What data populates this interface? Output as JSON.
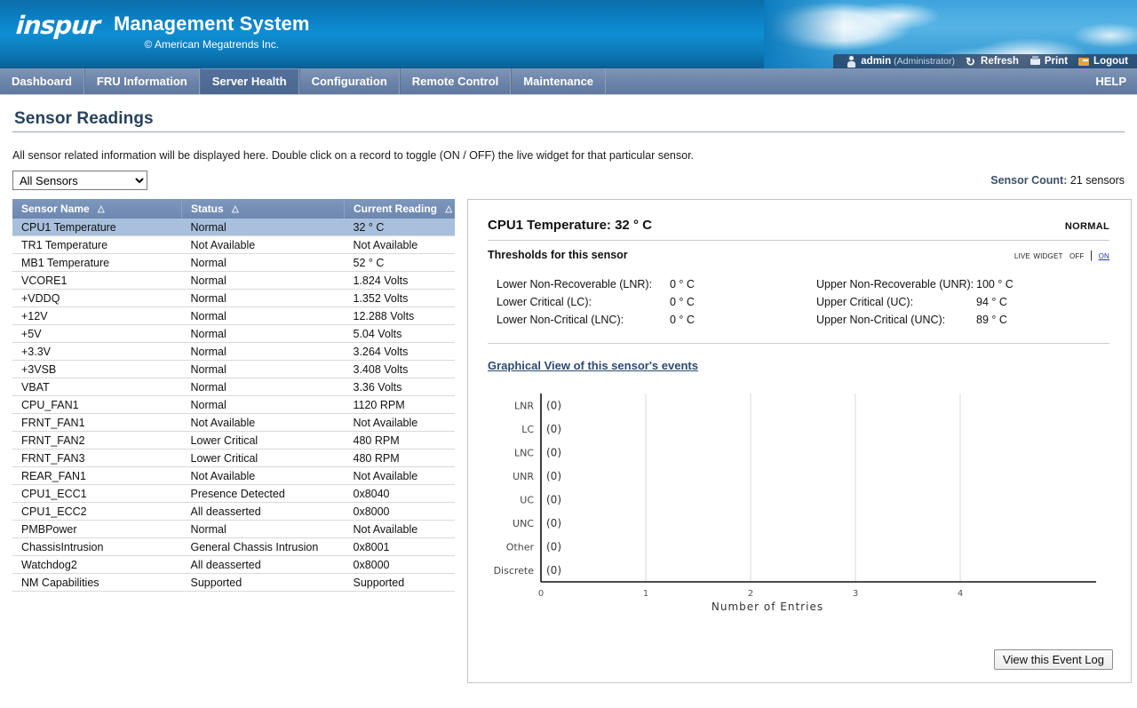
{
  "header": {
    "logo_text": "inspur",
    "title": "Management System",
    "subtitle": "© American Megatrends Inc.",
    "user": {
      "name": "admin",
      "role": "(Administrator)"
    },
    "actions": [
      {
        "label": "Refresh",
        "icon": "refresh-icon"
      },
      {
        "label": "Print",
        "icon": "print-icon"
      },
      {
        "label": "Logout",
        "icon": "logout-icon"
      }
    ]
  },
  "nav": {
    "items": [
      {
        "label": "Dashboard",
        "active": false
      },
      {
        "label": "FRU Information",
        "active": false
      },
      {
        "label": "Server Health",
        "active": true
      },
      {
        "label": "Configuration",
        "active": false
      },
      {
        "label": "Remote Control",
        "active": false
      },
      {
        "label": "Maintenance",
        "active": false
      }
    ],
    "help_label": "HELP"
  },
  "page": {
    "title": "Sensor Readings",
    "description": "All sensor related information will be displayed here. Double click on a record to toggle (ON / OFF) the live widget for that particular sensor.",
    "filter_selected": "All Sensors",
    "filter_options": [
      "All Sensors"
    ],
    "sensor_count_label": "Sensor Count:",
    "sensor_count_value": "21 sensors"
  },
  "table": {
    "columns": [
      "Sensor Name",
      "Status",
      "Current Reading"
    ],
    "sort_icon": "△",
    "rows": [
      {
        "name": "CPU1 Temperature",
        "status": "Normal",
        "reading": "32 ° C",
        "selected": true
      },
      {
        "name": "TR1 Temperature",
        "status": "Not Available",
        "reading": "Not Available",
        "selected": false
      },
      {
        "name": "MB1 Temperature",
        "status": "Normal",
        "reading": "52 ° C",
        "selected": false
      },
      {
        "name": "VCORE1",
        "status": "Normal",
        "reading": "1.824 Volts",
        "selected": false
      },
      {
        "name": "+VDDQ",
        "status": "Normal",
        "reading": "1.352 Volts",
        "selected": false
      },
      {
        "name": "+12V",
        "status": "Normal",
        "reading": "12.288 Volts",
        "selected": false
      },
      {
        "name": "+5V",
        "status": "Normal",
        "reading": "5.04 Volts",
        "selected": false
      },
      {
        "name": "+3.3V",
        "status": "Normal",
        "reading": "3.264 Volts",
        "selected": false
      },
      {
        "name": "+3VSB",
        "status": "Normal",
        "reading": "3.408 Volts",
        "selected": false
      },
      {
        "name": "VBAT",
        "status": "Normal",
        "reading": "3.36 Volts",
        "selected": false
      },
      {
        "name": "CPU_FAN1",
        "status": "Normal",
        "reading": "1120 RPM",
        "selected": false
      },
      {
        "name": "FRNT_FAN1",
        "status": "Not Available",
        "reading": "Not Available",
        "selected": false
      },
      {
        "name": "FRNT_FAN2",
        "status": "Lower Critical",
        "reading": "480 RPM",
        "selected": false
      },
      {
        "name": "FRNT_FAN3",
        "status": "Lower Critical",
        "reading": "480 RPM",
        "selected": false
      },
      {
        "name": "REAR_FAN1",
        "status": "Not Available",
        "reading": "Not Available",
        "selected": false
      },
      {
        "name": "CPU1_ECC1",
        "status": "Presence Detected",
        "reading": "0x8040",
        "selected": false
      },
      {
        "name": "CPU1_ECC2",
        "status": "All deasserted",
        "reading": "0x8000",
        "selected": false
      },
      {
        "name": "PMBPower",
        "status": "Normal",
        "reading": "Not Available",
        "selected": false
      },
      {
        "name": "ChassisIntrusion",
        "status": "General Chassis Intrusion",
        "reading": "0x8001",
        "selected": false
      },
      {
        "name": "Watchdog2",
        "status": "All deasserted",
        "reading": "0x8000",
        "selected": false
      },
      {
        "name": "NM Capabilities",
        "status": "Supported",
        "reading": "Supported",
        "selected": false
      }
    ]
  },
  "detail": {
    "title": "CPU1 Temperature: 32 ° C",
    "status": "Normal",
    "thresholds_label": "Thresholds for this sensor",
    "live_widget": {
      "label": "Live Widget",
      "off": "Off",
      "separator": "|",
      "on": "On"
    },
    "thresholds_left": [
      {
        "key": "Lower Non-Recoverable (LNR):",
        "value": "0 ° C"
      },
      {
        "key": "Lower Critical (LC):",
        "value": "0 ° C"
      },
      {
        "key": "Lower Non-Critical (LNC):",
        "value": "0 ° C"
      }
    ],
    "thresholds_right": [
      {
        "key": "Upper Non-Recoverable (UNR):",
        "value": "100 ° C"
      },
      {
        "key": "Upper Critical (UC):",
        "value": "94 ° C"
      },
      {
        "key": "Upper Non-Critical (UNC):",
        "value": "89 ° C"
      }
    ],
    "graph_link": "Graphical View of this sensor's events",
    "event_log_button": "View this Event Log"
  },
  "chart_data": {
    "type": "bar",
    "orientation": "horizontal",
    "title": "",
    "xlabel": "Number of Entries",
    "ylabel": "",
    "categories": [
      "LNR",
      "LC",
      "LNC",
      "UNR",
      "UC",
      "UNC",
      "Other",
      "Discrete"
    ],
    "values": [
      0,
      0,
      0,
      0,
      0,
      0,
      0,
      0
    ],
    "value_labels": [
      "(0)",
      "(0)",
      "(0)",
      "(0)",
      "(0)",
      "(0)",
      "(0)",
      "(0)"
    ],
    "xticks": [
      "0",
      "1",
      "2",
      "3",
      "4"
    ],
    "xlim": [
      0,
      5
    ],
    "grid": true,
    "legend": "none"
  },
  "colors": {
    "banner_blue": "#0f8ed3",
    "nav_blue": "#6d85aa",
    "nav_active": "#4b6890",
    "table_header": "#7e97bd",
    "row_selected": "#a8c0dd",
    "title_color": "#26415e",
    "link_blue": "#1b39b8"
  }
}
